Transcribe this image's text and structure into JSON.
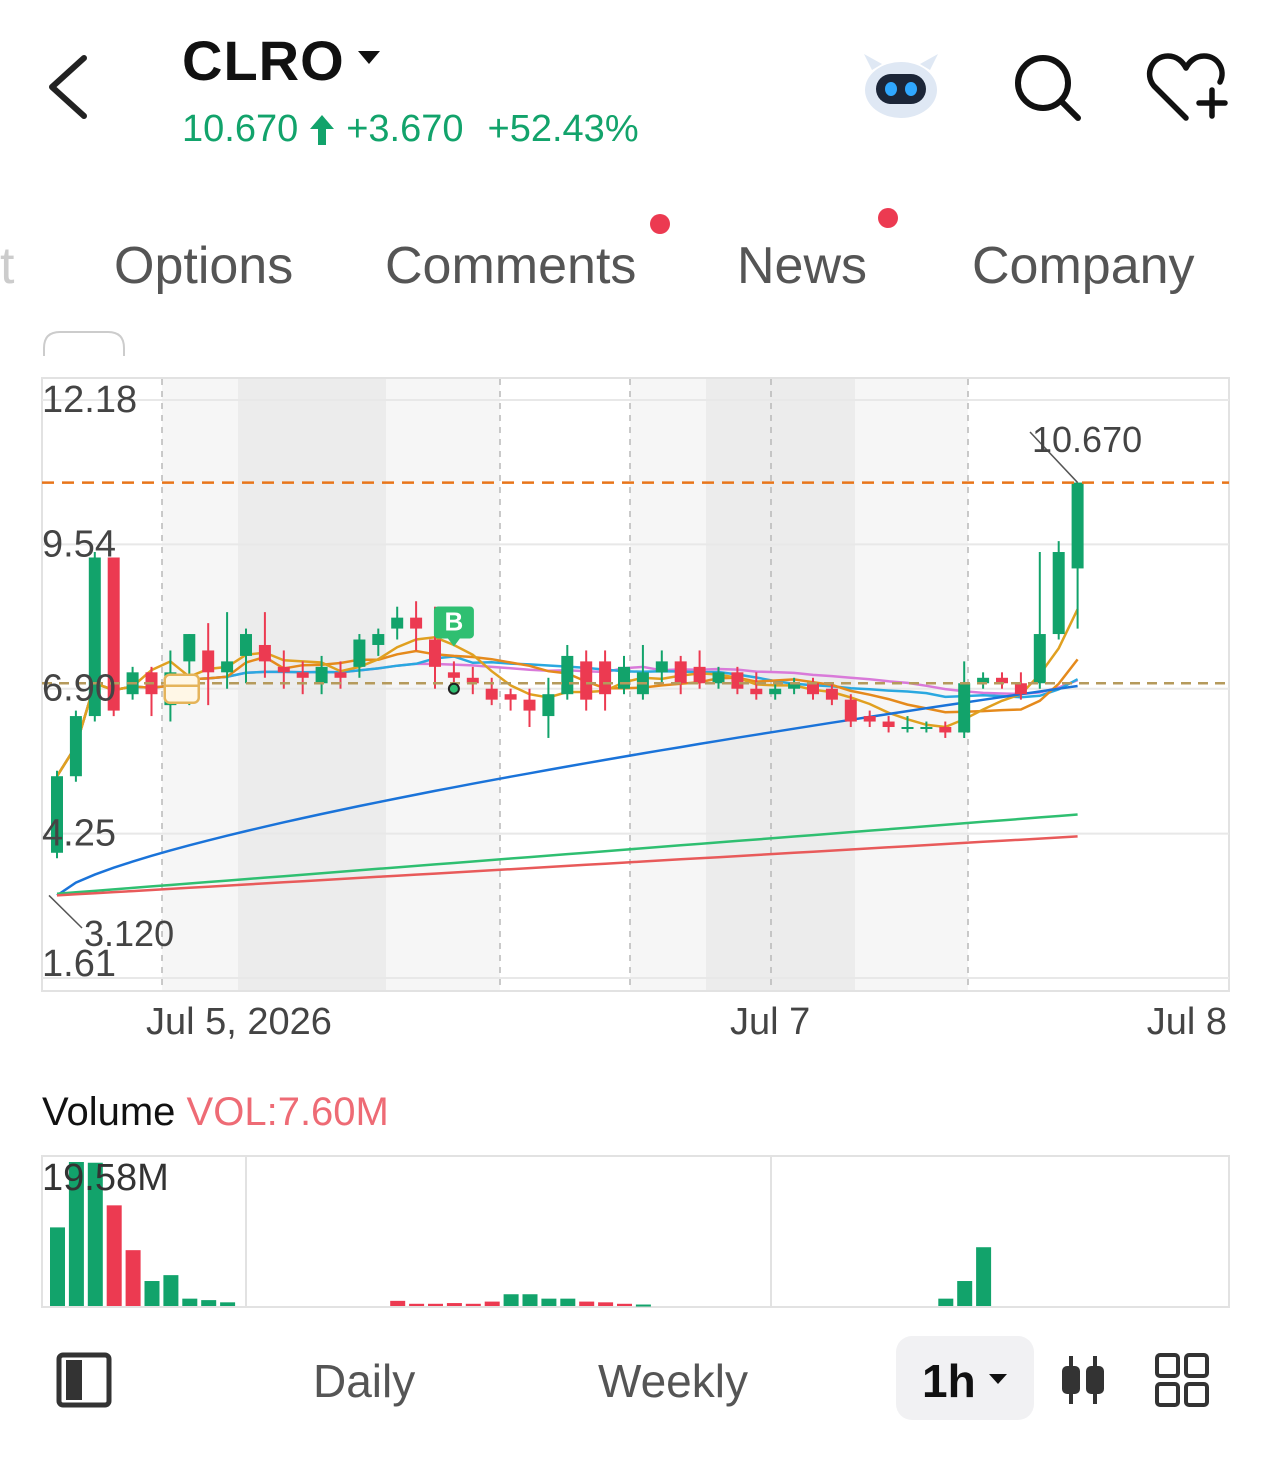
{
  "header": {
    "symbol": "CLRO",
    "price": "10.670",
    "change": "+3.670",
    "change_pct": "+52.43%",
    "accent_up": "#12a36b"
  },
  "tabs": [
    {
      "label": "t",
      "partial": true
    },
    {
      "label": "Options"
    },
    {
      "label": "Comments",
      "has_dot": true
    },
    {
      "label": "News",
      "has_dot": true
    },
    {
      "label": "Company"
    }
  ],
  "chart_data": {
    "type": "candlestick",
    "interval": "1h",
    "y_ticks": [
      "12.18",
      "9.54",
      "6.90",
      "4.25",
      "1.61"
    ],
    "ylim": [
      1.61,
      12.18
    ],
    "x_labels": [
      "Jul 5, 2026",
      "Jul 7",
      "Jul 8"
    ],
    "last_price_label": "10.670",
    "low_label": "3.120",
    "last_price": 10.67,
    "low_price": 3.12,
    "reference_price": 7.0,
    "marker": "B",
    "colors": {
      "up": "#12a36b",
      "down": "#ec3a51",
      "ma5": "#e0a020",
      "ma10": "#e58a1c",
      "ma20": "#2aa8e0",
      "ma30": "#d97ad9",
      "ma60": "#1a73d9",
      "ma120": "#2fbf71",
      "ma250": "#e85a5a"
    },
    "candles": [
      [
        3.9,
        5.3,
        3.8,
        5.4
      ],
      [
        5.3,
        6.4,
        5.2,
        6.5
      ],
      [
        6.4,
        9.3,
        6.3,
        9.4
      ],
      [
        9.3,
        6.5,
        6.4,
        9.3
      ],
      [
        6.8,
        7.2,
        6.7,
        7.3
      ],
      [
        7.2,
        6.8,
        6.4,
        7.3
      ],
      [
        6.6,
        7.2,
        6.3,
        7.6
      ],
      [
        7.4,
        7.9,
        6.6,
        7.9
      ],
      [
        7.6,
        7.2,
        6.6,
        8.1
      ],
      [
        7.2,
        7.4,
        6.9,
        8.3
      ],
      [
        7.5,
        7.9,
        7.0,
        8.0
      ],
      [
        7.7,
        7.4,
        7.1,
        8.3
      ],
      [
        7.3,
        7.2,
        6.9,
        7.6
      ],
      [
        7.2,
        7.1,
        6.8,
        7.4
      ],
      [
        7.0,
        7.3,
        6.8,
        7.5
      ],
      [
        7.2,
        7.1,
        6.9,
        7.4
      ],
      [
        7.3,
        7.8,
        7.1,
        7.9
      ],
      [
        7.7,
        7.9,
        7.5,
        8.0
      ],
      [
        8.0,
        8.2,
        7.8,
        8.4
      ],
      [
        8.2,
        8.0,
        7.6,
        8.5
      ],
      [
        7.8,
        7.3,
        6.9,
        8.4
      ],
      [
        7.2,
        7.1,
        6.9,
        7.4
      ],
      [
        7.1,
        7.0,
        6.8,
        7.3
      ],
      [
        6.9,
        6.7,
        6.6,
        7.1
      ],
      [
        6.8,
        6.7,
        6.5,
        6.9
      ],
      [
        6.7,
        6.5,
        6.2,
        6.9
      ],
      [
        6.4,
        6.8,
        6.0,
        7.1
      ],
      [
        6.8,
        7.5,
        6.7,
        7.7
      ],
      [
        7.4,
        6.7,
        6.5,
        7.6
      ],
      [
        7.4,
        6.8,
        6.5,
        7.6
      ],
      [
        6.9,
        7.3,
        6.8,
        7.5
      ],
      [
        6.8,
        7.2,
        6.7,
        7.7
      ],
      [
        7.2,
        7.4,
        7.0,
        7.6
      ],
      [
        7.4,
        7.0,
        6.8,
        7.5
      ],
      [
        7.3,
        7.0,
        6.9,
        7.6
      ],
      [
        7.0,
        7.2,
        6.9,
        7.3
      ],
      [
        7.2,
        6.9,
        6.8,
        7.3
      ],
      [
        6.9,
        6.8,
        6.7,
        7.2
      ],
      [
        6.8,
        6.9,
        6.7,
        7.0
      ],
      [
        6.9,
        7.0,
        6.8,
        7.1
      ],
      [
        7.0,
        6.8,
        6.7,
        7.1
      ],
      [
        6.9,
        6.7,
        6.6,
        7.0
      ],
      [
        6.7,
        6.3,
        6.2,
        6.8
      ],
      [
        6.4,
        6.3,
        6.2,
        6.5
      ],
      [
        6.3,
        6.2,
        6.1,
        6.4
      ],
      [
        6.2,
        6.2,
        6.1,
        6.4
      ],
      [
        6.2,
        6.2,
        6.1,
        6.3
      ],
      [
        6.2,
        6.1,
        6.0,
        6.3
      ],
      [
        6.1,
        7.0,
        6.0,
        7.4
      ],
      [
        7.0,
        7.1,
        6.9,
        7.2
      ],
      [
        7.1,
        7.0,
        6.9,
        7.2
      ],
      [
        7.0,
        6.8,
        6.7,
        7.2
      ],
      [
        7.0,
        7.9,
        6.9,
        9.4
      ],
      [
        7.9,
        9.4,
        7.8,
        9.6
      ],
      [
        9.1,
        10.67,
        8.0,
        10.67
      ]
    ],
    "volume": {
      "label": "Volume",
      "current": "VOL:7.60M",
      "max_label": "19.58M",
      "values": [
        10.7,
        19.6,
        19.5,
        13.7,
        7.6,
        3.4,
        4.2,
        1.0,
        0.8,
        0.5,
        0,
        0,
        0,
        0,
        0,
        0,
        0,
        0,
        0.7,
        0.3,
        0.3,
        0.4,
        0.3,
        0.6,
        1.6,
        1.6,
        1.0,
        1.0,
        0.6,
        0.5,
        0.3,
        0.2,
        0,
        0,
        0,
        0,
        0,
        0,
        0,
        0,
        0,
        0,
        0,
        0,
        0,
        0,
        0,
        1.0,
        3.4,
        8.0
      ],
      "up": [
        true,
        true,
        true,
        false,
        false,
        true,
        true,
        true,
        true,
        true,
        true,
        true,
        true,
        true,
        true,
        true,
        true,
        true,
        false,
        false,
        false,
        false,
        false,
        false,
        true,
        true,
        true,
        true,
        false,
        false,
        false,
        true,
        true,
        true,
        true,
        true,
        true,
        true,
        true,
        true,
        true,
        true,
        true,
        true,
        true,
        true,
        true,
        true,
        true,
        true
      ]
    }
  },
  "toolbar": {
    "daily": "Daily",
    "weekly": "Weekly",
    "timeframe": "1h"
  }
}
